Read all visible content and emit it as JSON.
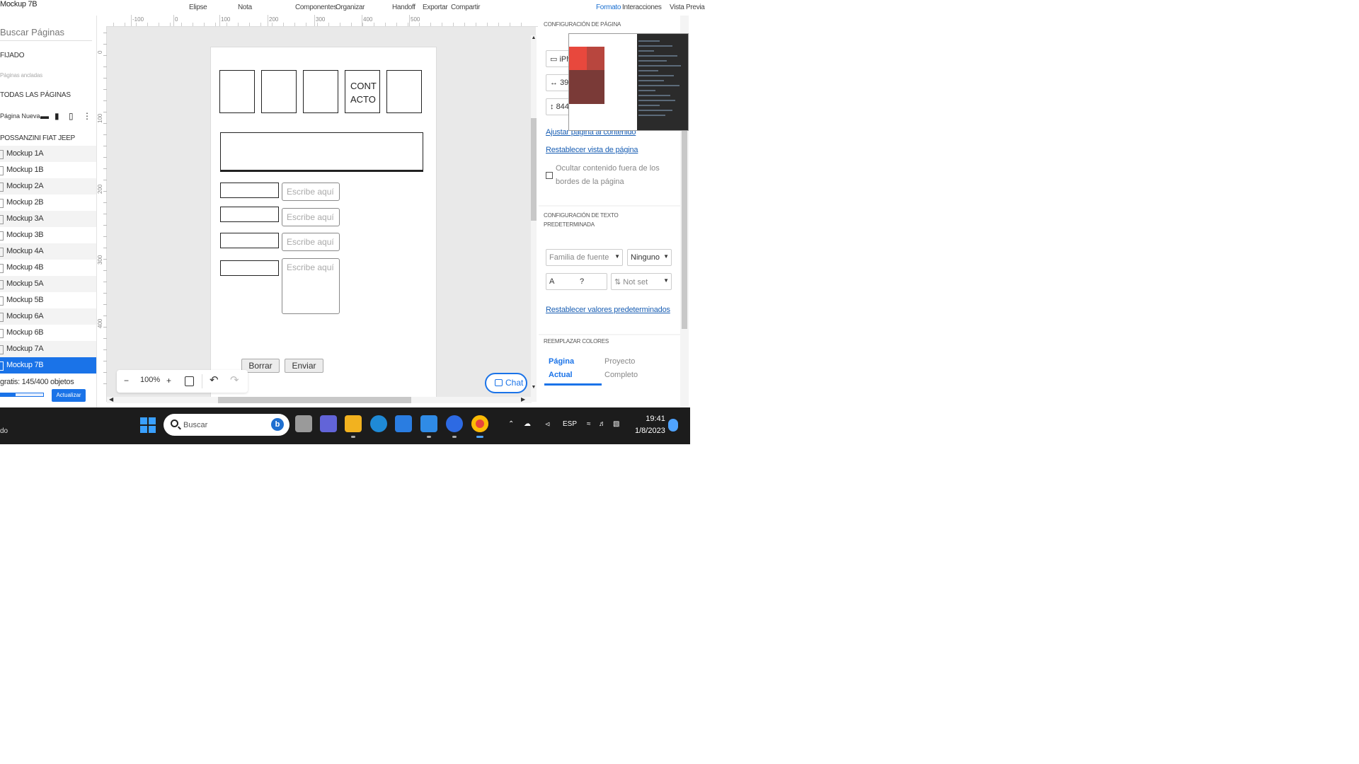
{
  "doc_title": "Mockup 7B",
  "toolbar": {
    "items": [
      "Elipse",
      "Nota",
      "Componentes",
      "Organizar",
      "Handoff",
      "Exportar",
      "Compartir",
      "Formato",
      "Interacciones",
      "Vista Previa"
    ],
    "active": "Formato"
  },
  "sidebar": {
    "search_placeholder": "Buscar Páginas",
    "section_pinned": "FIJADO",
    "pinned_hint": "Páginas ancladas",
    "section_all": "TODAS LAS PÁGINAS",
    "new_page": "Página Nueva",
    "group": "POSSANZINI FIAT JEEP",
    "pages": [
      "Mockup 1A",
      "Mockup 1B",
      "Mockup 2A",
      "Mockup 2B",
      "Mockup 3A",
      "Mockup 3B",
      "Mockup 4A",
      "Mockup 4B",
      "Mockup 5A",
      "Mockup 5B",
      "Mockup 6A",
      "Mockup 6B",
      "Mockup 7A",
      "Mockup 7B"
    ],
    "selected_page": "Mockup 7B",
    "object_count": "gratis: 145/400 objetos",
    "object_progress": 0.36,
    "update_label": "Actualizar"
  },
  "rulers": {
    "h_labels": [
      "-100",
      "0",
      "100",
      "200",
      "300",
      "400",
      "500"
    ],
    "v_labels": [
      "0",
      "100",
      "200",
      "300",
      "400"
    ]
  },
  "mockup": {
    "nav_boxes": [
      "",
      "",
      "",
      "CONT ACTO",
      ""
    ],
    "placeholder": "Escribe aquí",
    "btn_clear": "Borrar",
    "btn_send": "Enviar"
  },
  "zoom": {
    "minus": "−",
    "level": "100%",
    "plus": "+"
  },
  "chat_label": "Chat",
  "panel": {
    "page_config_title": "CONFIGURACIÓN DE PÁGINA",
    "device_value": "iPh",
    "width_value": "390",
    "height_value": "844",
    "fit_link": "Ajustar página al contenido",
    "reset_view_link": "Restablecer vista de página",
    "hide_content_label": "Ocultar contenido fuera de los bordes de la página",
    "text_config_title": "CONFIGURACIÓN DE TEXTO PREDETERMINADA",
    "font_family_placeholder": "Familia de fuente",
    "font_weight": "Ninguno",
    "size_prefix": "A",
    "size_value": "?",
    "line_height": "Not set",
    "reset_defaults_link": "Restablecer valores predeterminados",
    "replace_colors_title": "REEMPLAZAR COLORES",
    "tab_current": "Página Actual",
    "tab_project": "Proyecto Completo"
  },
  "taskbar": {
    "left_text": "do",
    "search_placeholder": "Buscar",
    "lang": "ESP",
    "time": "19:41",
    "date": "1/8/2023"
  },
  "colors": {
    "accent": "#1a73e8",
    "taskbar": "#1c1c1c"
  }
}
